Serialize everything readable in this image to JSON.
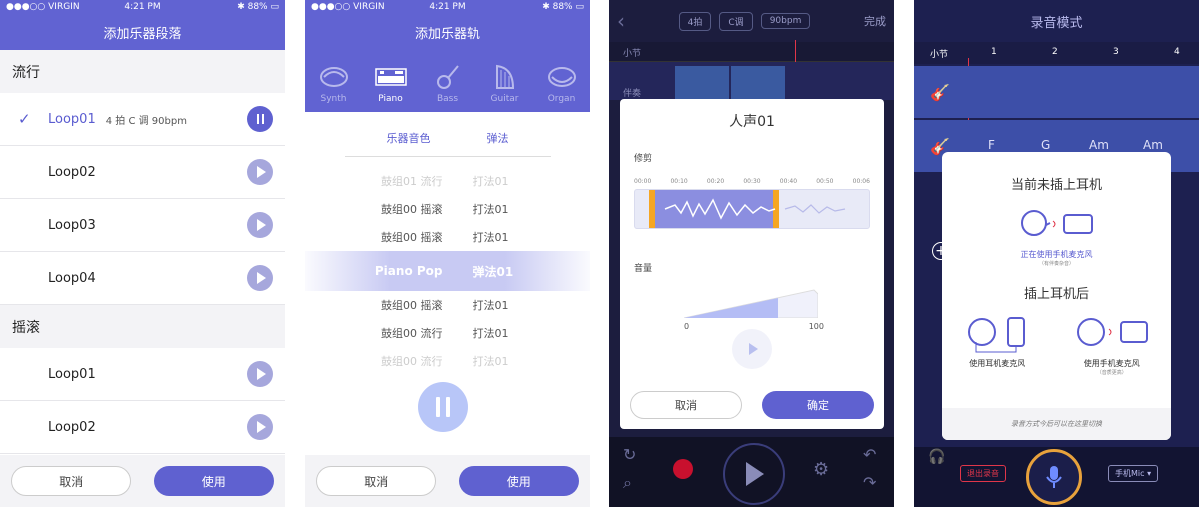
{
  "status": {
    "carrier": "VIRGIN",
    "time": "4:21 PM",
    "battery": "88%"
  },
  "screen1": {
    "title": "添加乐器段落",
    "sections": [
      {
        "name": "流行",
        "items": [
          {
            "name": "Loop01",
            "meta": "4 拍  C 调  90bpm",
            "selected": true
          },
          {
            "name": "Loop02"
          },
          {
            "name": "Loop03"
          },
          {
            "name": "Loop04"
          }
        ]
      },
      {
        "name": "摇滚",
        "items": [
          {
            "name": "Loop01"
          },
          {
            "name": "Loop02"
          }
        ]
      }
    ],
    "cancel": "取消",
    "use": "使用"
  },
  "screen2": {
    "title": "添加乐器轨",
    "instruments": [
      "Synth",
      "Piano",
      "Bass",
      "Guitar",
      "Organ"
    ],
    "active_instrument": "Piano",
    "tabs": [
      "乐器音色",
      "弹法"
    ],
    "picker": [
      {
        "a": "鼓组01  流行",
        "b": "打法01",
        "faint": true
      },
      {
        "a": "鼓组00  摇滚",
        "b": "打法01"
      },
      {
        "a": "鼓组00  摇滚",
        "b": "打法01"
      },
      {
        "a": "Piano Pop",
        "b": "弹法01",
        "selected": true
      },
      {
        "a": "鼓组00  摇滚",
        "b": "打法01"
      },
      {
        "a": "鼓组00  流行",
        "b": "打法01"
      },
      {
        "a": "鼓组00  流行",
        "b": "打法01",
        "faint": true
      }
    ],
    "cancel": "取消",
    "use": "使用"
  },
  "screen3": {
    "pills": [
      "4拍",
      "C调",
      "90bpm"
    ],
    "done": "完成",
    "bar_label": "小节",
    "accomp_label": "伴奏",
    "modal_title": "人声01",
    "trim_label": "修剪",
    "ruler": [
      "00:00",
      "00:10",
      "00:20",
      "00:30",
      "00:40",
      "00:50",
      "00:06"
    ],
    "volume_label": "音量",
    "vol_min": "0",
    "vol_max": "100",
    "cancel": "取消",
    "confirm": "确定"
  },
  "screen4": {
    "title": "录音模式",
    "bar_label": "小节",
    "bar_numbers": [
      "1",
      "2",
      "3",
      "4"
    ],
    "chords": [
      "F",
      "G",
      "Am",
      "Am"
    ],
    "modal_h1": "当前未插上耳机",
    "using_phone_mic": "正在使用手机麦克风",
    "with_accomp": "（有伴奏杂音）",
    "modal_h2": "插上耳机后",
    "opt1": "使用耳机麦克风",
    "opt2": "使用手机麦克风",
    "opt2_sub": "（音质更高）",
    "footer": "录音方式今后可以在这里切换",
    "exit_record": "退出录音",
    "mic_mode": "手机Mic"
  }
}
